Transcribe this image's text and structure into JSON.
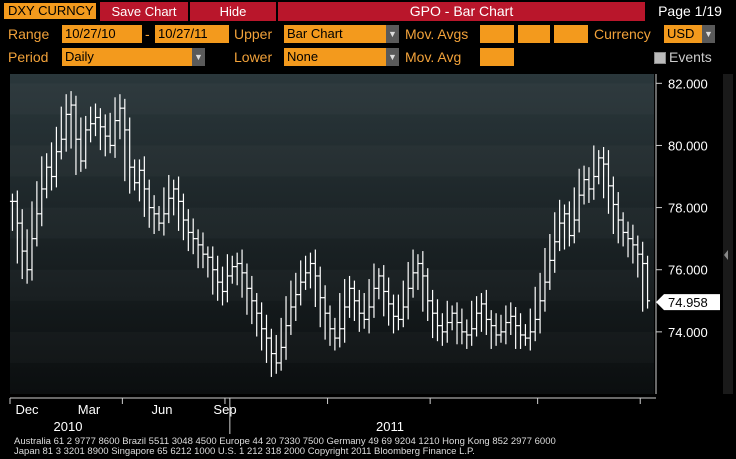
{
  "toolbar": {
    "ticker": "DXY CURNCY",
    "save_chart": "Save Chart",
    "hide": "Hide",
    "title": "GPO - Bar Chart",
    "page": "Page 1/19"
  },
  "controls": {
    "range_label": "Range",
    "range_start": "10/27/10",
    "range_dash": "-",
    "range_end": "10/27/11",
    "upper_label": "Upper",
    "upper_value": "Bar Chart",
    "mov_avgs_label": "Mov. Avgs",
    "currency_label": "Currency",
    "currency_value": "USD",
    "period_label": "Period",
    "period_value": "Daily",
    "lower_label": "Lower",
    "lower_value": "None",
    "mov_avg_label": "Mov. Avg",
    "events_label": "Events"
  },
  "colors": {
    "accent": "#f39a1d",
    "button": "#b9162b",
    "plot_bg_top": "#283438",
    "plot_bg_bottom": "#0c0f10",
    "bars": "#ffffff"
  },
  "footer": {
    "line1": "Australia 61 2 9777 8600 Brazil 5511 3048 4500 Europe 44 20 7330 7500 Germany 49 69 9204 1210 Hong Kong 852 2977 6000",
    "line2": "Japan 81 3 3201 8900          Singapore 65 6212 1000          U.S. 1 212 318 2000          Copyright 2011 Bloomberg Finance L.P."
  },
  "chart_data": {
    "type": "bar",
    "subtype": "ohlc",
    "x_ticks": [
      "Dec",
      "Mar",
      "Jun",
      "Sep"
    ],
    "year_labels": [
      "2010",
      "2011"
    ],
    "y_ticks": [
      "82.000",
      "80.000",
      "78.000",
      "76.000",
      "74.000"
    ],
    "ylim": [
      72.0,
      82.3
    ],
    "last_value": "74.958",
    "series": [
      {
        "values": [
          78.2,
          77.5,
          76.6,
          76.0,
          77.0,
          77.8,
          78.6,
          79.3,
          79.0,
          79.8,
          80.2,
          81.0,
          81.3,
          80.2,
          79.5,
          80.5,
          80.7,
          80.9,
          80.6,
          80.3,
          80.0,
          80.8,
          81.2,
          80.5,
          79.3,
          78.8,
          79.2,
          78.6,
          78.0,
          77.8,
          77.5,
          77.8,
          78.3,
          78.6,
          78.2,
          77.6,
          77.2,
          77.0,
          76.8,
          76.5,
          76.4,
          76.0,
          75.6,
          75.3,
          75.8,
          76.1,
          76.2,
          75.9,
          75.4,
          75.0,
          74.6,
          74.1,
          73.8,
          73.3,
          73.0,
          73.5,
          74.2,
          74.8,
          75.2,
          75.6,
          75.9,
          76.2,
          75.8,
          75.1,
          74.6,
          74.1,
          73.8,
          74.1,
          74.8,
          75.4,
          75.0,
          74.6,
          74.4,
          74.8,
          75.4,
          75.8,
          75.3,
          74.9,
          74.5,
          74.4,
          74.8,
          75.4,
          75.9,
          76.2,
          75.8,
          75.0,
          74.6,
          74.2,
          74.0,
          74.3,
          74.6,
          74.3,
          74.0,
          73.9,
          74.1,
          74.6,
          74.9,
          74.4,
          74.2,
          73.9,
          74.0,
          74.3,
          74.5,
          74.2,
          73.9,
          73.8,
          74.0,
          74.4,
          75.0,
          75.6,
          76.3,
          76.9,
          77.5,
          77.8,
          77.1,
          77.6,
          78.4,
          78.9,
          78.6,
          79.0,
          79.6,
          79.4,
          78.7,
          78.1,
          77.6,
          77.2,
          77.0,
          76.8,
          76.5,
          76.2,
          75.0
        ]
      }
    ]
  }
}
